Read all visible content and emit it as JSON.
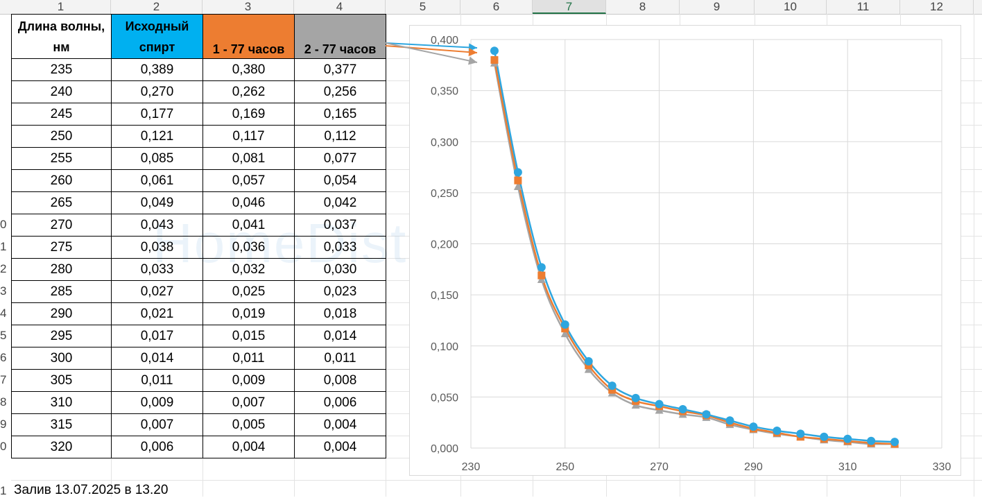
{
  "column_headers": [
    "1",
    "2",
    "3",
    "4",
    "5",
    "6",
    "7",
    "8",
    "9",
    "10",
    "11",
    "12"
  ],
  "row_numbers": [
    "",
    "",
    "",
    "",
    "",
    "",
    "",
    "",
    "",
    "0",
    "1",
    "2",
    "3",
    "4",
    "5",
    "6",
    "7",
    "8",
    "9",
    "0",
    "1"
  ],
  "table": {
    "headers": [
      "Длина волны, нм",
      "Исходный спирт",
      "1 - 77 часов",
      "2 - 77 часов"
    ],
    "header_colors": [
      "#ffffff",
      "#00b0f0",
      "#ed7d31",
      "#a5a5a5"
    ],
    "rows": [
      [
        "235",
        "0,389",
        "0,380",
        "0,377"
      ],
      [
        "240",
        "0,270",
        "0,262",
        "0,256"
      ],
      [
        "245",
        "0,177",
        "0,169",
        "0,165"
      ],
      [
        "250",
        "0,121",
        "0,117",
        "0,112"
      ],
      [
        "255",
        "0,085",
        "0,081",
        "0,077"
      ],
      [
        "260",
        "0,061",
        "0,057",
        "0,054"
      ],
      [
        "265",
        "0,049",
        "0,046",
        "0,042"
      ],
      [
        "270",
        "0,043",
        "0,041",
        "0,037"
      ],
      [
        "275",
        "0,038",
        "0,036",
        "0,033"
      ],
      [
        "280",
        "0,033",
        "0,032",
        "0,030"
      ],
      [
        "285",
        "0,027",
        "0,025",
        "0,023"
      ],
      [
        "290",
        "0,021",
        "0,019",
        "0,018"
      ],
      [
        "295",
        "0,017",
        "0,015",
        "0,014"
      ],
      [
        "300",
        "0,014",
        "0,011",
        "0,011"
      ],
      [
        "305",
        "0,011",
        "0,009",
        "0,008"
      ],
      [
        "310",
        "0,009",
        "0,007",
        "0,006"
      ],
      [
        "315",
        "0,007",
        "0,005",
        "0,004"
      ],
      [
        "320",
        "0,006",
        "0,004",
        "0,004"
      ]
    ]
  },
  "footer_text": "Залив 13.07.2025 в 13.20",
  "watermark": "HomeDistiller.ru",
  "chart_data": {
    "type": "scatter",
    "x": [
      235,
      240,
      245,
      250,
      255,
      260,
      265,
      270,
      275,
      280,
      285,
      290,
      295,
      300,
      305,
      310,
      315,
      320
    ],
    "series": [
      {
        "color": "#2ea6df",
        "marker": "circle",
        "values": [
          0.389,
          0.27,
          0.177,
          0.121,
          0.085,
          0.061,
          0.049,
          0.043,
          0.038,
          0.033,
          0.027,
          0.021,
          0.017,
          0.014,
          0.011,
          0.009,
          0.007,
          0.006
        ]
      },
      {
        "color": "#ed7d31",
        "marker": "square",
        "values": [
          0.38,
          0.262,
          0.169,
          0.117,
          0.081,
          0.057,
          0.046,
          0.041,
          0.036,
          0.032,
          0.025,
          0.019,
          0.015,
          0.011,
          0.009,
          0.007,
          0.005,
          0.004
        ]
      },
      {
        "color": "#a5a5a5",
        "marker": "triangle",
        "values": [
          0.377,
          0.256,
          0.165,
          0.112,
          0.077,
          0.054,
          0.042,
          0.037,
          0.033,
          0.03,
          0.023,
          0.018,
          0.014,
          0.011,
          0.008,
          0.006,
          0.004,
          0.004
        ]
      }
    ],
    "xlim": [
      230,
      330
    ],
    "ylim": [
      0,
      0.4
    ],
    "x_ticks": [
      "230",
      "250",
      "270",
      "290",
      "310",
      "330"
    ],
    "y_ticks": [
      "0,000",
      "0,050",
      "0,100",
      "0,150",
      "0,200",
      "0,250",
      "0,300",
      "0,350",
      "0,400"
    ],
    "grid": true,
    "smooth_lines": true,
    "title": "",
    "xlabel": "",
    "ylabel": ""
  }
}
